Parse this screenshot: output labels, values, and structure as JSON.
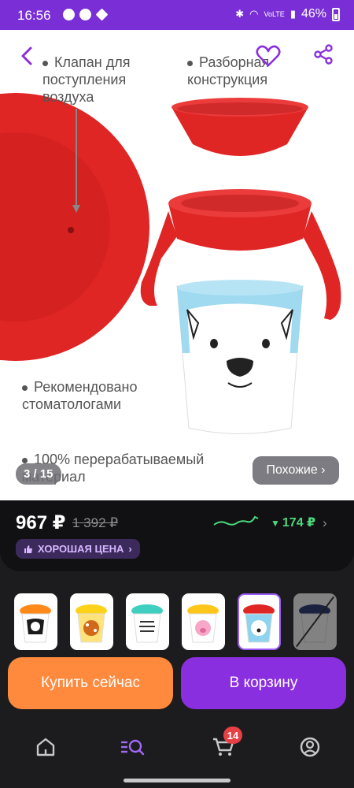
{
  "status_bar": {
    "time": "16:56",
    "network": "VoLTE",
    "battery": "46%"
  },
  "product": {
    "features": [
      "Клапан для поступления воздуха",
      "Разборная конструкция",
      "Рекомендовано стоматологами",
      "100% перерабатываемый материал"
    ],
    "image_counter": "3 / 15",
    "similar_label": "Похожие ›"
  },
  "price": {
    "current": "967 ₽",
    "old": "1 392 ₽",
    "change": "174 ₽",
    "badge": "ХОРОШАЯ ЦЕНА"
  },
  "actions": {
    "buy_now": "Купить сейчас",
    "add_to_cart": "В корзину"
  },
  "nav": {
    "cart_count": "14"
  },
  "colors": {
    "accent": "#8a2fe0",
    "buy": "#ff8a3d",
    "positive": "#4cd97b",
    "status_bar": "#7a2fd6"
  },
  "thumbnails": [
    {
      "icon": "orange-cup-penguin"
    },
    {
      "icon": "yellow-cup-giraffe"
    },
    {
      "icon": "teal-cup-zebra"
    },
    {
      "icon": "yellow-cup-pig"
    },
    {
      "icon": "red-cup-polar-bear",
      "selected": true
    },
    {
      "icon": "navy-cup-disabled"
    }
  ]
}
